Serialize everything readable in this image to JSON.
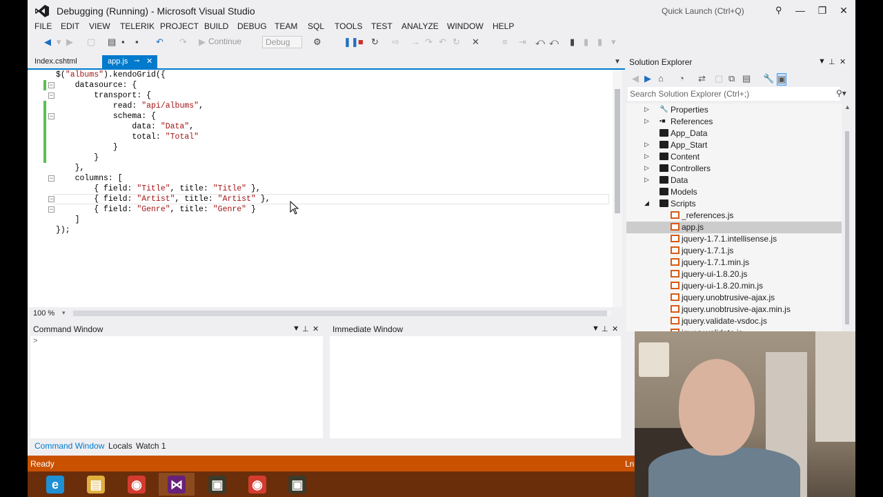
{
  "window": {
    "title": "Debugging (Running) - Microsoft Visual Studio",
    "quick_launch_placeholder": "Quick Launch (Ctrl+Q)"
  },
  "menu": [
    "FILE",
    "EDIT",
    "VIEW",
    "TELERIK",
    "PROJECT",
    "BUILD",
    "DEBUG",
    "TEAM",
    "SQL",
    "TOOLS",
    "TEST",
    "ANALYZE",
    "WINDOW",
    "HELP"
  ],
  "toolbar": {
    "continue_label": "Continue",
    "config_value": "Debug"
  },
  "editor": {
    "tabs": [
      {
        "label": "Index.cshtml",
        "active": false
      },
      {
        "label": "app.js",
        "active": true
      }
    ],
    "zoom": "100 %",
    "code_lines": [
      "$(\"albums\").kendoGrid({",
      "    datasource: {",
      "        transport: {",
      "            read: \"api/albums\",",
      "            schema: {",
      "                data: \"Data\",",
      "                total: \"Total\"",
      "            }",
      "        }",
      "    },",
      "    columns: [",
      "        { field: \"Title\", title: \"Title\" },",
      "        { field: \"Artist\", title: \"Artist\" },",
      "        { field: \"Genre\", title: \"Genre\" }",
      "    ]",
      "});"
    ]
  },
  "panels": {
    "command_window_title": "Command Window",
    "immediate_window_title": "Immediate Window",
    "command_prompt": ">",
    "bottom_tabs": [
      "Command Window",
      "Locals",
      "Watch 1"
    ]
  },
  "solution_explorer": {
    "title": "Solution Explorer",
    "search_placeholder": "Search Solution Explorer (Ctrl+;)",
    "items": [
      {
        "label": "Properties",
        "type": "wrench",
        "expander": "▷"
      },
      {
        "label": "References",
        "type": "refs",
        "expander": "▷"
      },
      {
        "label": "App_Data",
        "type": "folder",
        "expander": ""
      },
      {
        "label": "App_Start",
        "type": "folder",
        "expander": "▷"
      },
      {
        "label": "Content",
        "type": "folder",
        "expander": "▷"
      },
      {
        "label": "Controllers",
        "type": "folder",
        "expander": "▷"
      },
      {
        "label": "Data",
        "type": "folder",
        "expander": "▷"
      },
      {
        "label": "Models",
        "type": "folder",
        "expander": ""
      },
      {
        "label": "Scripts",
        "type": "folder",
        "expander": "◢"
      },
      {
        "label": "_references.js",
        "type": "js",
        "expander": ""
      },
      {
        "label": "app.js",
        "type": "js",
        "expander": "",
        "selected": true
      },
      {
        "label": "jquery-1.7.1.intellisense.js",
        "type": "js",
        "expander": ""
      },
      {
        "label": "jquery-1.7.1.js",
        "type": "js",
        "expander": ""
      },
      {
        "label": "jquery-1.7.1.min.js",
        "type": "js",
        "expander": ""
      },
      {
        "label": "jquery-ui-1.8.20.js",
        "type": "js",
        "expander": ""
      },
      {
        "label": "jquery-ui-1.8.20.min.js",
        "type": "js",
        "expander": ""
      },
      {
        "label": "jquery.unobtrusive-ajax.js",
        "type": "js",
        "expander": ""
      },
      {
        "label": "jquery.unobtrusive-ajax.min.js",
        "type": "js",
        "expander": ""
      },
      {
        "label": "jquery.validate-vsdoc.js",
        "type": "js",
        "expander": ""
      },
      {
        "label": "jquery.validate.js",
        "type": "js",
        "expander": ""
      }
    ]
  },
  "status": {
    "text": "Ready",
    "ln": "Ln"
  },
  "taskbar": [
    {
      "icon": "ie-icon",
      "glyph": "e",
      "color": "#1e90d6",
      "active": false
    },
    {
      "icon": "file-explorer-icon",
      "glyph": "▤",
      "color": "#e0b040",
      "active": false
    },
    {
      "icon": "chrome-icon",
      "glyph": "◉",
      "color": "#d43b2f",
      "active": false
    },
    {
      "icon": "visual-studio-icon",
      "glyph": "⋈",
      "color": "#68217a",
      "active": true
    },
    {
      "icon": "app-icon",
      "glyph": "▣",
      "color": "#3b3b2b",
      "active": false
    },
    {
      "icon": "chrome-icon",
      "glyph": "◉",
      "color": "#d43b2f",
      "active": false
    },
    {
      "icon": "app-icon",
      "glyph": "▣",
      "color": "#3b3b2b",
      "active": false
    }
  ],
  "colors": {
    "accent": "#007acc",
    "statusbar": "#ca5100",
    "taskbar": "#6b2e0b",
    "string": "#a31515"
  }
}
